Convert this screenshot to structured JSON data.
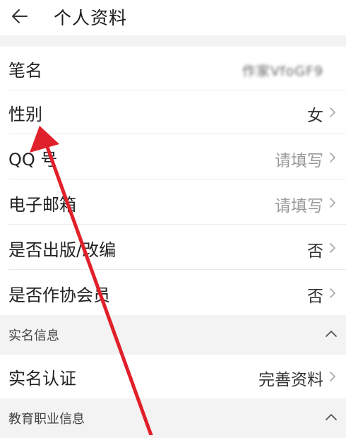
{
  "header": {
    "title": "个人资料"
  },
  "rows": [
    {
      "label": "笔名",
      "value": "作家VfoGF9"
    },
    {
      "label": "性别",
      "value": "女"
    },
    {
      "label": "QQ 号",
      "value": "请填写"
    },
    {
      "label": "电子邮箱",
      "value": "请填写"
    },
    {
      "label": "是否出版/改编",
      "value": "否"
    },
    {
      "label": "是否作协会员",
      "value": "否"
    }
  ],
  "sections": [
    {
      "label": "实名信息"
    },
    {
      "label": "教育职业信息"
    }
  ],
  "verify": {
    "label": "实名认证",
    "value": "完善资料"
  },
  "colors": {
    "annotation_arrow": "#e0202a",
    "section_bg": "#f3f3f3",
    "hint_text": "#9a9a9a"
  },
  "icons": {
    "back": "arrow-left-icon",
    "row": "chevron-right-icon",
    "section": "chevron-up-icon"
  }
}
